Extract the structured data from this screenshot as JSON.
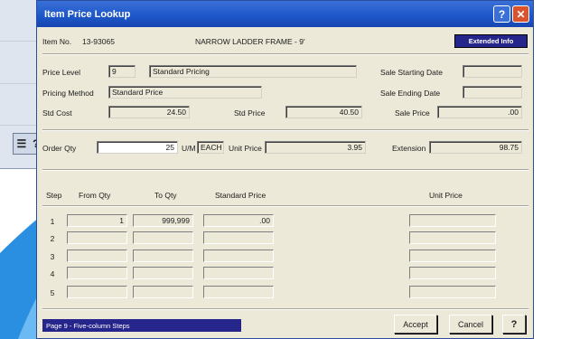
{
  "bg": {
    "help_glyph": "?",
    "list_glyph": "☰"
  },
  "window": {
    "title": "Item Price Lookup",
    "help_label": "?",
    "close_label": "✕"
  },
  "item": {
    "label": "Item No.",
    "number": "13-93065",
    "description": "NARROW LADDER FRAME - 9'",
    "extended_info_label": "Extended Info"
  },
  "pricing": {
    "price_level_label": "Price Level",
    "price_level_code": "9",
    "price_level_name": "Standard Pricing",
    "method_label": "Pricing Method",
    "method_value": "Standard Price",
    "std_cost_label": "Std Cost",
    "std_cost_value": "24.50",
    "std_price_label": "Std Price",
    "std_price_value": "40.50",
    "sale_start_label": "Sale Starting Date",
    "sale_start_value": "",
    "sale_end_label": "Sale Ending Date",
    "sale_end_value": "",
    "sale_price_label": "Sale Price",
    "sale_price_value": ".00"
  },
  "order": {
    "qty_label": "Order Qty",
    "qty_value": "25",
    "uom_label": "U/M",
    "uom_value": "EACH",
    "unit_price_label": "Unit Price",
    "unit_price_value": "3.95",
    "extension_label": "Extension",
    "extension_value": "98.75"
  },
  "grid": {
    "headers": {
      "step": "Step",
      "from": "From Qty",
      "to": "To Qty",
      "std": "Standard Price",
      "unit": "Unit Price"
    },
    "rows": [
      {
        "step": "1",
        "from": "1",
        "to": "999,999",
        "std": ".00",
        "unit": ""
      },
      {
        "step": "2",
        "from": "",
        "to": "",
        "std": "",
        "unit": ""
      },
      {
        "step": "3",
        "from": "",
        "to": "",
        "std": "",
        "unit": ""
      },
      {
        "step": "4",
        "from": "",
        "to": "",
        "std": "",
        "unit": ""
      },
      {
        "step": "5",
        "from": "",
        "to": "",
        "std": "",
        "unit": ""
      }
    ]
  },
  "status": {
    "text": "Page 9 - Five-column Steps"
  },
  "buttons": {
    "accept": "Accept",
    "cancel": "Cancel",
    "help": "?"
  }
}
